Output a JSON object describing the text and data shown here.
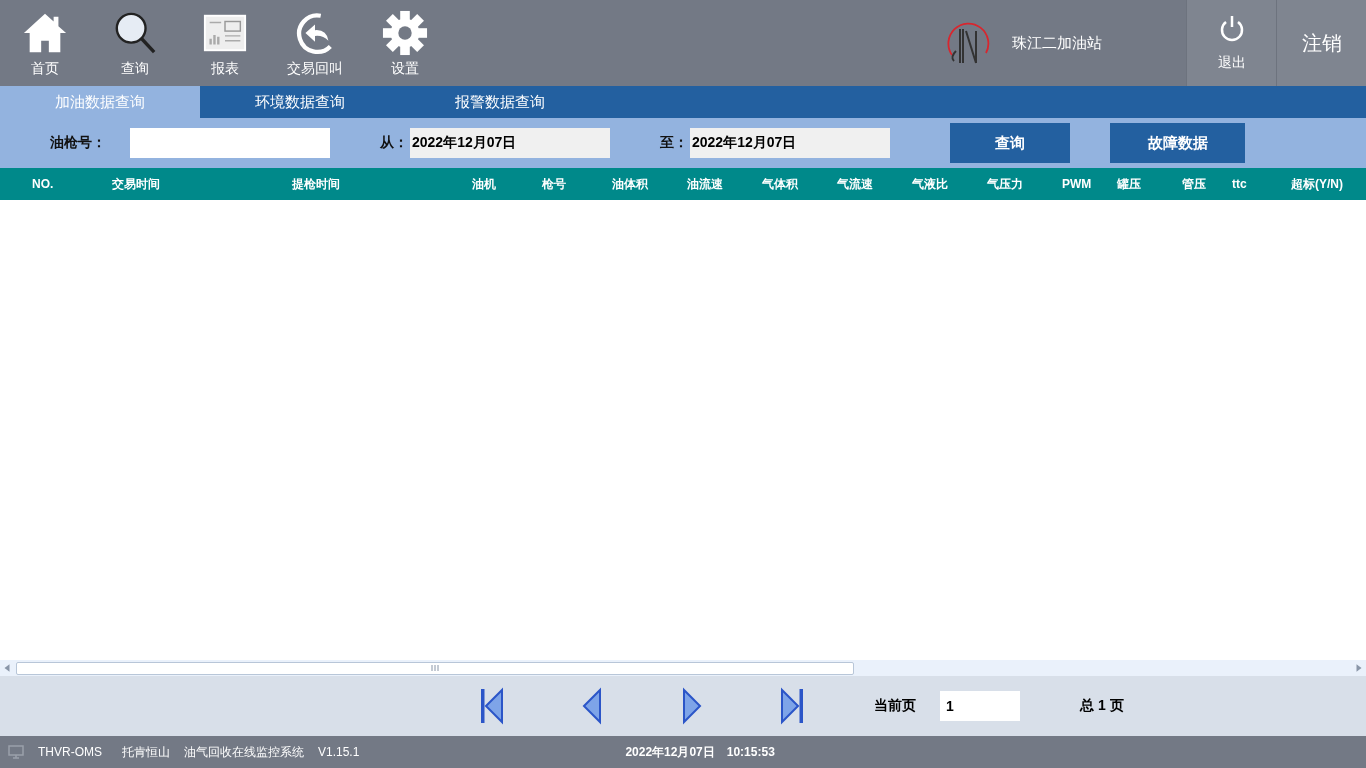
{
  "nav": [
    {
      "label": "首页"
    },
    {
      "label": "查询"
    },
    {
      "label": "报表"
    },
    {
      "label": "交易回叫"
    },
    {
      "label": "设置"
    }
  ],
  "station": "珠江二加油站",
  "exit_button": {
    "label": "退出"
  },
  "logout_button": {
    "label": "注销"
  },
  "tabs": [
    {
      "label": "加油数据查询",
      "selected": true
    },
    {
      "label": "环境数据查询",
      "selected": false
    },
    {
      "label": "报警数据查询",
      "selected": false
    }
  ],
  "filter": {
    "nozzle_label": "油枪号：",
    "from_label": "从：",
    "from_value": "2022年12月07日",
    "to_label": "至：",
    "to_value": "2022年12月07日",
    "query_button": "查询",
    "fault_button": "故障数据"
  },
  "table": {
    "columns": [
      "NO.",
      "交易时间",
      "提枪时间",
      "油机",
      "枪号",
      "油体积",
      "油流速",
      "气体积",
      "气流速",
      "气液比",
      "气压力",
      "PWM",
      "罐压",
      "管压",
      "ttc",
      "超标(Y/N)"
    ]
  },
  "pager": {
    "current_label": "当前页",
    "current_value": "1",
    "total": "总 1 页"
  },
  "status_bar": {
    "app": "THVR-OMS",
    "company": "托肯恒山",
    "system": "油气回收在线监控系统",
    "version": "V1.15.1",
    "date": "2022年12月07日",
    "time": "10:15:53"
  }
}
